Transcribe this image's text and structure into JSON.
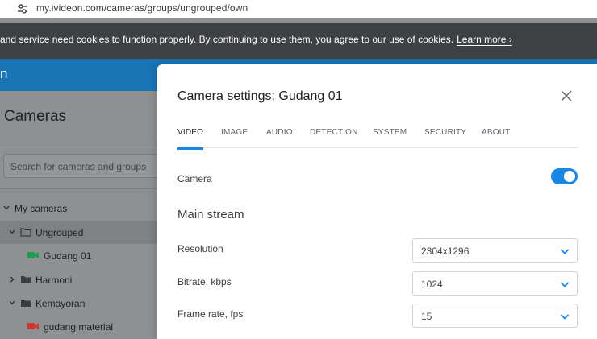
{
  "browser": {
    "url": "my.ivideon.com/cameras/groups/ungrouped/own",
    "site_icon": "tune-icon"
  },
  "cookie_banner": {
    "text": "and service need cookies to function properly. By continuing to use them, you agree to our use of cookies.",
    "link": "Learn more ›"
  },
  "appbar": {
    "logo_fragment": "n",
    "color": "#1975b6"
  },
  "sidebar": {
    "title": "Cameras",
    "search_placeholder": "Search for cameras and groups",
    "tree": [
      {
        "label": "My cameras",
        "expanded": true,
        "icon": "none",
        "selected": false
      },
      {
        "label": "Ungrouped",
        "expanded": true,
        "icon": "folder-outline-icon",
        "selected": true
      },
      {
        "label": "Gudang 01",
        "icon": "camera-green-icon",
        "selected": false
      },
      {
        "label": "Harmoni",
        "expanded": false,
        "icon": "folder-icon",
        "selected": false
      },
      {
        "label": "Kemayoran",
        "expanded": true,
        "icon": "folder-icon",
        "selected": false
      },
      {
        "label": "gudang material",
        "icon": "camera-red-icon",
        "selected": false
      }
    ]
  },
  "modal": {
    "title": "Camera settings: Gudang 01",
    "tabs": [
      "VIDEO",
      "IMAGE",
      "AUDIO",
      "DETECTION",
      "SYSTEM",
      "SECURITY",
      "ABOUT"
    ],
    "active_tab": "VIDEO",
    "camera_label": "Camera",
    "camera_enabled": true,
    "section_title": "Main stream",
    "fields": [
      {
        "label": "Resolution",
        "value": "2304x1296"
      },
      {
        "label": "Bitrate, kbps",
        "value": "1024"
      },
      {
        "label": "Frame rate, fps",
        "value": "15"
      }
    ],
    "accent_color": "#1a87e5"
  }
}
